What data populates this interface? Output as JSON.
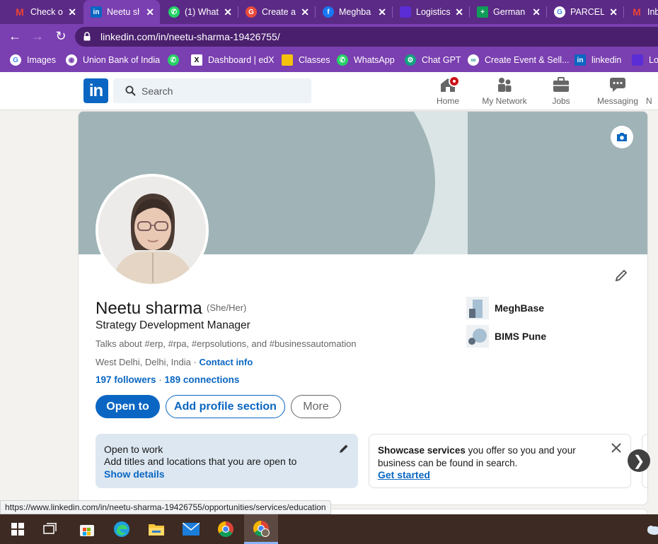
{
  "browser": {
    "tabs": [
      {
        "label": "Check o",
        "icon": "gmail-icon",
        "color": "#ea4335"
      },
      {
        "label": "Neetu sh",
        "icon": "linkedin-icon",
        "color": "#0a66c2",
        "active": true
      },
      {
        "label": "(1) What",
        "icon": "whatsapp-icon",
        "color": "#25d366"
      },
      {
        "label": "Create a",
        "icon": "grammarly-icon",
        "color": "#e84b3c"
      },
      {
        "label": "Meghba",
        "icon": "facebook-icon",
        "color": "#1877f2"
      },
      {
        "label": "Logistics",
        "icon": "logistics-icon",
        "color": "#5b2dd6"
      },
      {
        "label": "German",
        "icon": "sheets-icon",
        "color": "#0f9d58"
      },
      {
        "label": "PARCEL",
        "icon": "google-icon",
        "color": "#ffffff"
      },
      {
        "label": "Inb",
        "icon": "gmail-icon",
        "color": "#ea4335"
      }
    ],
    "url": "linkedin.com/in/neetu-sharma-19426755/",
    "bookmarks": [
      {
        "label": "Images",
        "icon": "google-icon"
      },
      {
        "label": "Union Bank of India",
        "icon": "globe-icon"
      },
      {
        "label": "",
        "icon": "whatsapp-icon"
      },
      {
        "label": "Dashboard | edX",
        "icon": "edx-icon"
      },
      {
        "label": "Classes",
        "icon": "classroom-icon"
      },
      {
        "label": "WhatsApp",
        "icon": "whatsapp-icon"
      },
      {
        "label": "Chat GPT",
        "icon": "chatgpt-icon"
      },
      {
        "label": "Create Event & Sell...",
        "icon": "event-icon"
      },
      {
        "label": "linkedin",
        "icon": "linkedin-icon"
      },
      {
        "label": "Lo",
        "icon": "logistics-icon"
      }
    ],
    "status_url": "https://www.linkedin.com/in/neetu-sharma-19426755/opportunities/services/education"
  },
  "linkedin": {
    "logo": "in",
    "search_placeholder": "Search",
    "nav": [
      {
        "label": "Home",
        "icon": "home-icon"
      },
      {
        "label": "My Network",
        "icon": "network-icon"
      },
      {
        "label": "Jobs",
        "icon": "briefcase-icon"
      },
      {
        "label": "Messaging",
        "icon": "messaging-icon"
      },
      {
        "label": "N",
        "icon": "bell-icon"
      }
    ]
  },
  "profile": {
    "name": "Neetu sharma",
    "pronouns": "(She/Her)",
    "headline": "Strategy Development Manager",
    "talks_about": "Talks about #erp, #rpa, #erpsolutions, and #businessautomation",
    "location": "West Delhi, Delhi, India",
    "location_sep": " · ",
    "contact_info": "Contact info",
    "followers": "197 followers",
    "connections": "189 connections",
    "buttons": {
      "open_to": "Open to",
      "add_section": "Add profile section",
      "more": "More"
    },
    "orgs": [
      {
        "label": "MeghBase"
      },
      {
        "label": "BIMS Pune"
      }
    ],
    "open_to_work": {
      "title": "Open to work",
      "body": "Add titles and locations that you are open to",
      "link": "Show details"
    },
    "showcase": {
      "bold": "Showcase services",
      "rest": " you offer so you and your business can be found in search.",
      "link": "Get started"
    }
  },
  "colors": {
    "brand": "#0a66c2",
    "chrome_frame": "#7a3fb0"
  }
}
